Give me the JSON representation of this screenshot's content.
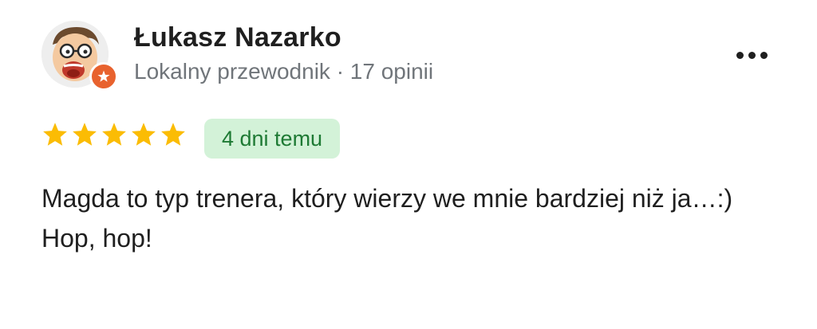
{
  "author": {
    "name": "Łukasz Nazarko",
    "meta": "Lokalny przewodnik · 17 opinii",
    "avatar_icon": "cartoon-avatar",
    "badge_icon": "local-guide-star-icon",
    "badge_color": "#e8622e"
  },
  "rating": {
    "stars": 5,
    "max": 5,
    "star_color": "#fbbc04"
  },
  "date_chip": {
    "label": "4 dni temu",
    "bg_color": "#d3f2d8",
    "text_color": "#1e7a34"
  },
  "review": {
    "line1": "Magda to typ trenera, który wierzy we mnie bardziej niż ja…:)",
    "line2": "Hop, hop!"
  },
  "menu": {
    "icon": "more-horizontal-icon"
  }
}
